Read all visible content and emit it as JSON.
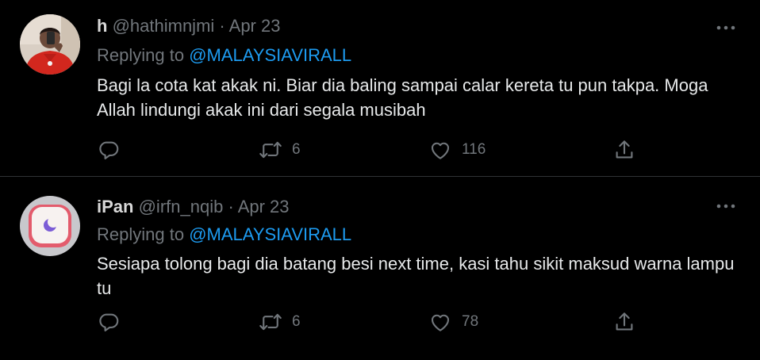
{
  "tweets": [
    {
      "display_name": "h",
      "handle": "@hathimnjmi",
      "separator": "·",
      "date": "Apr 23",
      "replying_prefix": "Replying to",
      "replying_to": "@MALAYSIAVIRALL",
      "text": "Bagi la cota kat akak ni. Biar dia baling sampai calar kereta tu pun takpa. Moga Allah lindungi akak ini dari segala musibah",
      "retweets": "6",
      "likes": "116",
      "avatar": "photo-of-person-in-red-shirt"
    },
    {
      "display_name": "iPan",
      "handle": "@irfn_nqib",
      "separator": "·",
      "date": "Apr 23",
      "replying_prefix": "Replying to",
      "replying_to": "@MALAYSIAVIRALL",
      "text": "Sesiapa tolong bagi dia batang besi next time, kasi tahu sikit maksud warna lampu tu",
      "retweets": "6",
      "likes": "78",
      "avatar": "pink-moon-app-icon"
    }
  ],
  "icons": {
    "more": "more-options-icon",
    "reply": "reply-icon",
    "retweet": "retweet-icon",
    "like": "like-icon",
    "share": "share-icon"
  },
  "colors": {
    "background": "#000000",
    "text": "#e7e9ea",
    "muted": "#71767b",
    "link": "#1d9bf0",
    "divider": "#2f3336"
  }
}
